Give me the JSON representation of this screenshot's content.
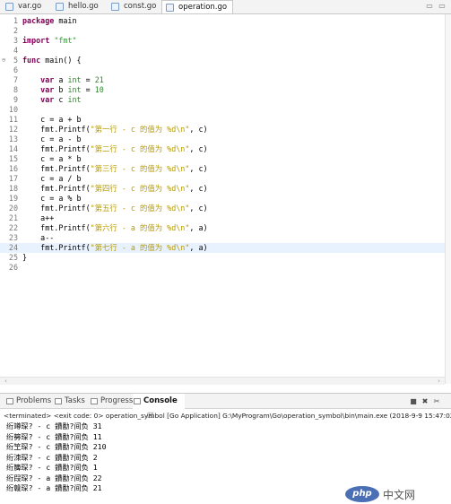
{
  "editor_tabs": [
    {
      "label": "var.go"
    },
    {
      "label": "hello.go"
    },
    {
      "label": "const.go"
    },
    {
      "label": "operation.go",
      "close": "☒"
    }
  ],
  "window_buttons": {
    "minimize": "▭",
    "maximize": "▭"
  },
  "code_lines": [
    {
      "n": "1",
      "segments": [
        [
          "kw",
          "package"
        ],
        [
          "",
          " main"
        ]
      ]
    },
    {
      "n": "2",
      "segments": []
    },
    {
      "n": "3",
      "segments": [
        [
          "kw",
          "import"
        ],
        [
          "",
          " "
        ],
        [
          "str",
          "\"fmt\""
        ]
      ]
    },
    {
      "n": "4",
      "segments": []
    },
    {
      "n": "5",
      "fold": "⊖",
      "segments": [
        [
          "kw",
          "func"
        ],
        [
          "",
          " main() {"
        ]
      ]
    },
    {
      "n": "6",
      "segments": []
    },
    {
      "n": "7",
      "segments": [
        [
          "",
          "    "
        ],
        [
          "kw",
          "var"
        ],
        [
          "",
          " a "
        ],
        [
          "ty",
          "int"
        ],
        [
          "",
          " = "
        ],
        [
          "num",
          "21"
        ]
      ]
    },
    {
      "n": "8",
      "segments": [
        [
          "",
          "    "
        ],
        [
          "kw",
          "var"
        ],
        [
          "",
          " b "
        ],
        [
          "ty",
          "int"
        ],
        [
          "",
          " = "
        ],
        [
          "num",
          "10"
        ]
      ]
    },
    {
      "n": "9",
      "segments": [
        [
          "",
          "    "
        ],
        [
          "kw",
          "var"
        ],
        [
          "",
          " c "
        ],
        [
          "ty",
          "int"
        ]
      ]
    },
    {
      "n": "10",
      "segments": []
    },
    {
      "n": "11",
      "segments": [
        [
          "",
          "    c = a + b"
        ]
      ]
    },
    {
      "n": "12",
      "segments": [
        [
          "",
          "    fmt.Printf("
        ],
        [
          "zh",
          "\"第一行 - c 的值为 %d\\n\""
        ],
        [
          "",
          ", c)"
        ]
      ]
    },
    {
      "n": "13",
      "segments": [
        [
          "",
          "    c = a - b"
        ]
      ]
    },
    {
      "n": "14",
      "segments": [
        [
          "",
          "    fmt.Printf("
        ],
        [
          "zh",
          "\"第二行 - c 的值为 %d\\n\""
        ],
        [
          "",
          ", c)"
        ]
      ]
    },
    {
      "n": "15",
      "segments": [
        [
          "",
          "    c = a * b"
        ]
      ]
    },
    {
      "n": "16",
      "segments": [
        [
          "",
          "    fmt.Printf("
        ],
        [
          "zh",
          "\"第三行 - c 的值为 %d\\n\""
        ],
        [
          "",
          ", c)"
        ]
      ]
    },
    {
      "n": "17",
      "segments": [
        [
          "",
          "    c = a / b"
        ]
      ]
    },
    {
      "n": "18",
      "segments": [
        [
          "",
          "    fmt.Printf("
        ],
        [
          "zh",
          "\"第四行 - c 的值为 %d\\n\""
        ],
        [
          "",
          ", c)"
        ]
      ]
    },
    {
      "n": "19",
      "segments": [
        [
          "",
          "    c = a % b"
        ]
      ]
    },
    {
      "n": "20",
      "segments": [
        [
          "",
          "    fmt.Printf("
        ],
        [
          "zh",
          "\"第五行 - c 的值为 %d\\n\""
        ],
        [
          "",
          ", c)"
        ]
      ]
    },
    {
      "n": "21",
      "segments": [
        [
          "",
          "    a++"
        ]
      ]
    },
    {
      "n": "22",
      "segments": [
        [
          "",
          "    fmt.Printf("
        ],
        [
          "zh",
          "\"第六行 - a 的值为 %d\\n\""
        ],
        [
          "",
          ", a)"
        ]
      ]
    },
    {
      "n": "23",
      "segments": [
        [
          "",
          "    a--"
        ]
      ]
    },
    {
      "n": "24",
      "highlight": true,
      "segments": [
        [
          "",
          "    fmt.Printf("
        ],
        [
          "zh",
          "\"第七行 - a 的值为 %d\\n\""
        ],
        [
          "",
          ", a)"
        ]
      ]
    },
    {
      "n": "25",
      "segments": [
        [
          "",
          "}"
        ]
      ]
    },
    {
      "n": "26",
      "segments": []
    }
  ],
  "panel_tabs": [
    {
      "label": "Problems"
    },
    {
      "label": "Tasks"
    },
    {
      "label": "Progress"
    },
    {
      "label": "Console",
      "close": "☒"
    }
  ],
  "panel_buttons": {
    "stop": "■",
    "remove": "✖",
    "clear": "✂"
  },
  "console": {
    "terminated": "<terminated> <exit code: 0> operation_symbol [Go Application] G:\\MyProgram\\Go\\operation_symbol\\bin\\main.exe (2018-9-9 15:47:02)",
    "lines": [
      "绗竴琛? - c 鐨勫?间负 31",
      "绗簩琛? - c 鐨勫?间负 11",
      "绗笁琛? - c 鐨勫?间负 210",
      "绗洓琛? - c 鐨勫?间负 2",
      "绗簲琛? - c 鐨勫?间负 1",
      "绗叚琛? - a 鐨勫?间负 22",
      "绗竷琛? - a 鐨勫?间负 21"
    ]
  },
  "watermark": {
    "logo": "php",
    "text": "中文网"
  }
}
